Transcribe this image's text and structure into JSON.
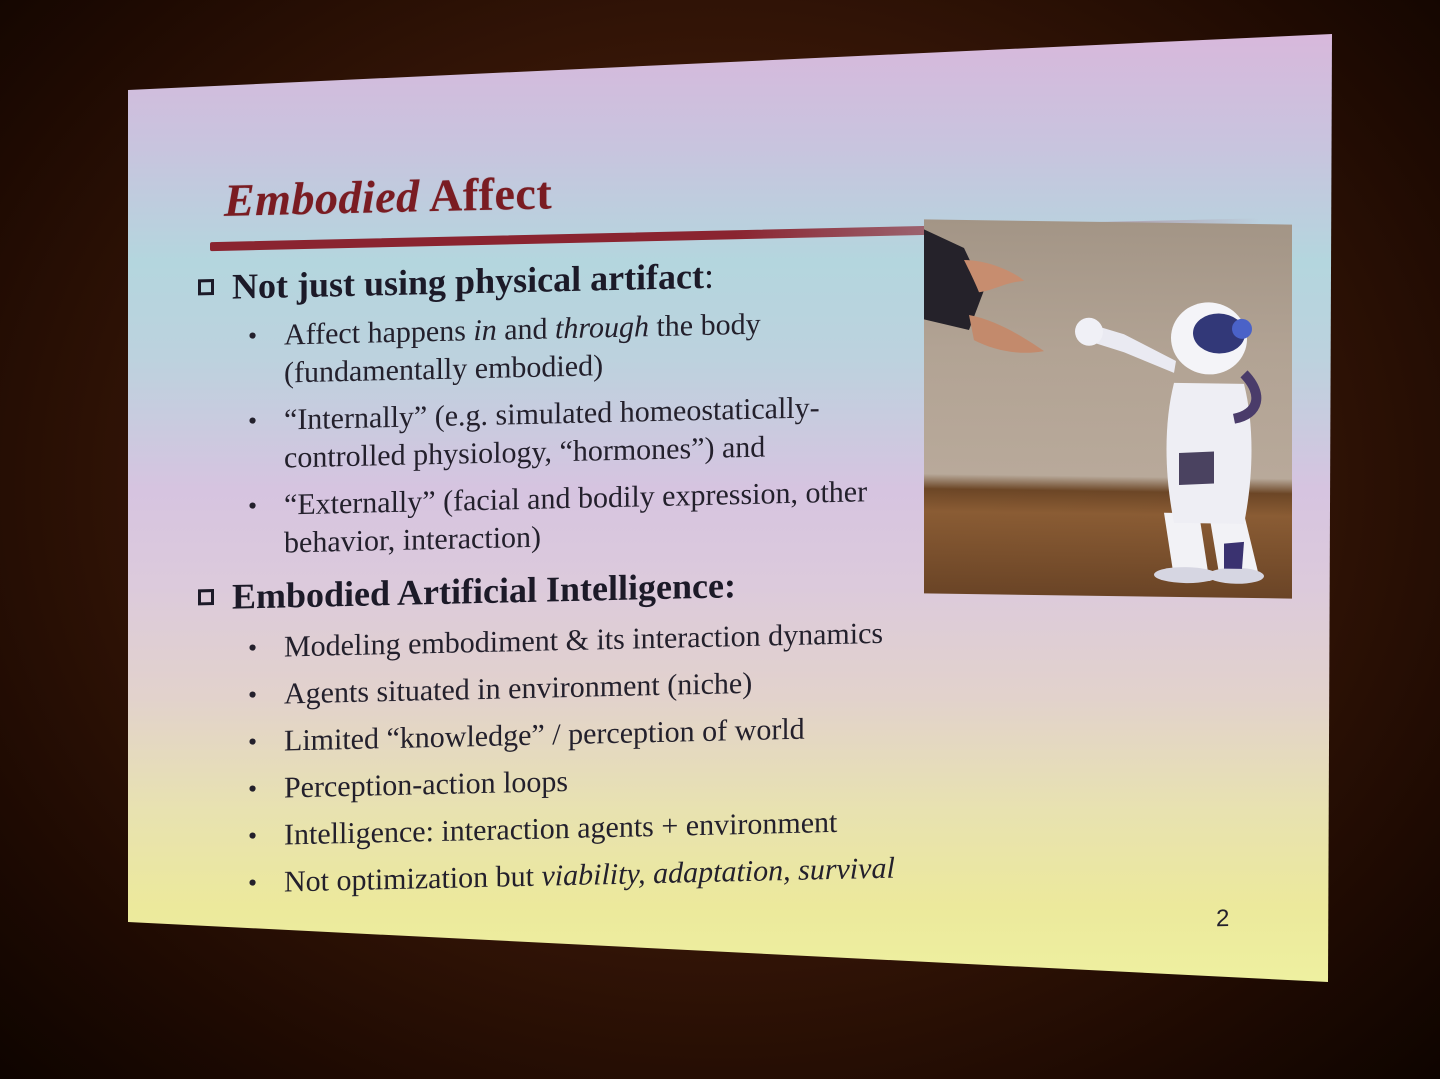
{
  "slide": {
    "title_italic": "Embodied",
    "title_rest": "Affect",
    "section1": {
      "label_bold": "Not just using physical artifact",
      "label_suffix": ":"
    },
    "section1_bullets": [
      {
        "pre": "Affect happens ",
        "it1": "in",
        "mid": " and ",
        "it2": "through",
        "post": " the body (fundamentally embodied)"
      },
      {
        "text": "“Internally” (e.g. simulated homeostatically-controlled physiology, “hormones”) and"
      },
      {
        "text": "“Externally” (facial and bodily expression, other behavior, interaction)"
      }
    ],
    "section2": {
      "label": "Embodied Artificial Intelligence:"
    },
    "section2_bullets": [
      {
        "text": "Modeling embodiment & its interaction dynamics"
      },
      {
        "text": "Agents situated in environment (niche)"
      },
      {
        "text": "Limited “knowledge” / perception of world"
      },
      {
        "text": "Perception-action loops"
      },
      {
        "text": "Intelligence: interaction agents + environment"
      },
      {
        "pre": "Not optimization but ",
        "italic": "viability, adaptation, survival"
      }
    ],
    "page_number": "2"
  },
  "image": {
    "description_icon": "robot-photo"
  },
  "colors": {
    "title": "#7a1c22",
    "rule": "#8a2430",
    "text": "#23202c"
  }
}
